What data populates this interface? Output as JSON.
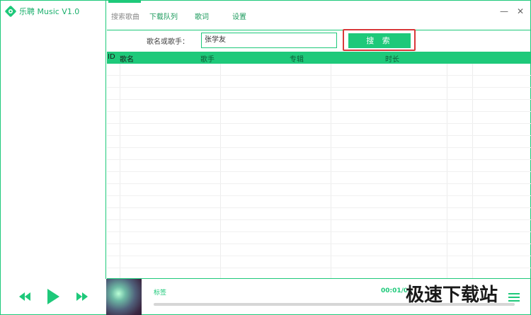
{
  "app": {
    "title": "乐聘 Music V1.0"
  },
  "nav": {
    "tabs": [
      {
        "label": "搜索歌曲",
        "active": true
      },
      {
        "label": "下载队列",
        "active": false
      },
      {
        "label": "歌词",
        "active": false
      },
      {
        "label": "设置",
        "active": false
      }
    ]
  },
  "window": {
    "minimize_symbol": "—",
    "close_symbol": "✕"
  },
  "search": {
    "label": "歌名或歌手：",
    "value": "张学友",
    "button_label": "搜 索"
  },
  "table": {
    "columns": [
      "ID",
      "歌名",
      "歌手",
      "专辑",
      "时长"
    ],
    "rows": []
  },
  "player": {
    "track_label": "标签",
    "time": "00:01/04",
    "progress": 0,
    "controls": [
      "previous-icon",
      "play-icon",
      "next-icon"
    ]
  },
  "watermark": {
    "text": "极速下载站"
  },
  "colors": {
    "accent": "#1ec97a",
    "highlight": "#d9383a"
  }
}
